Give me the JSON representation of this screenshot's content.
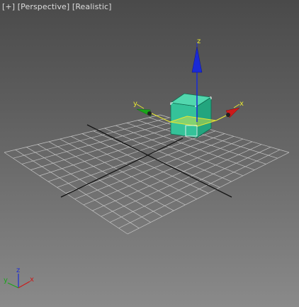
{
  "viewport": {
    "menu_label": "[+]",
    "view_label": "[Perspective]",
    "shading_label": "[Realistic]"
  },
  "gizmo": {
    "x_label": "x",
    "y_label": "y",
    "z_label": "z"
  },
  "axis_tripod": {
    "x_label": "x",
    "y_label": "y",
    "z_label": "z"
  },
  "colors": {
    "x_axis": "#cc1a1a",
    "y_axis": "#1aa51a",
    "z_axis": "#1a2ad6",
    "box": "#3cc8a0",
    "selection_plane": "#e6e632",
    "grid": "#c8c8c8"
  }
}
